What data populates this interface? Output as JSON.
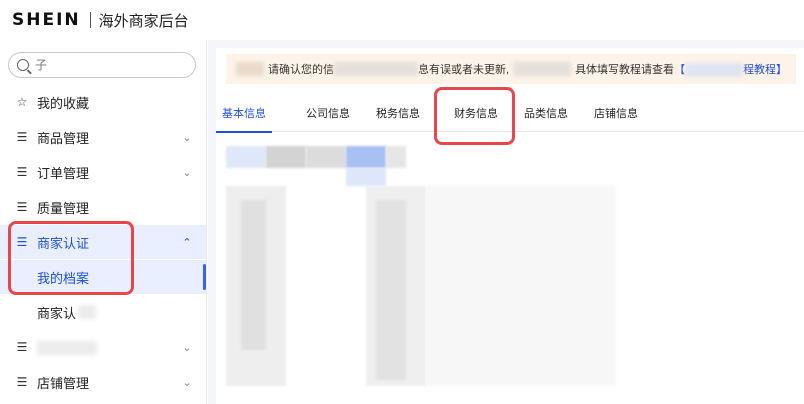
{
  "header": {
    "logo": "SHEIN",
    "title": "海外商家后台"
  },
  "search": {
    "placeholder": "子"
  },
  "sidebar": {
    "items": [
      {
        "label": "我的收藏",
        "icon": "star-icon",
        "chevron": false
      },
      {
        "label": "商品管理",
        "icon": "list-icon",
        "chevron": true
      },
      {
        "label": "订单管理",
        "icon": "list-icon",
        "chevron": true
      },
      {
        "label": "质量管理",
        "icon": "list-icon",
        "chevron": false
      },
      {
        "label": "商家认证",
        "icon": "list-icon",
        "chevron": true,
        "expanded": true
      }
    ],
    "sub_items": [
      {
        "label": "我的档案",
        "active": true
      },
      {
        "label": "商家认"
      }
    ],
    "bottom_items": [
      {
        "label": "",
        "icon": "list-icon",
        "chevron": true
      },
      {
        "label": "店铺管理",
        "icon": "list-icon",
        "chevron": true
      }
    ]
  },
  "notice": {
    "part1": "请确认您的信",
    "part2": "息有误或者未更新,",
    "part3": "具体填写教程请查看",
    "link": "【",
    "link_end": "程教程】"
  },
  "tabs": [
    {
      "label": "基本信息",
      "active": true
    },
    {
      "label": "公司信息"
    },
    {
      "label": "税务信息"
    },
    {
      "label": "财务信息"
    },
    {
      "label": "品类信息"
    },
    {
      "label": "店铺信息"
    }
  ],
  "colors": {
    "accent": "#1f4fd8",
    "highlight": "#e8464b",
    "active_bg": "#e9efff",
    "notice_bg": "#fdf3e8"
  }
}
